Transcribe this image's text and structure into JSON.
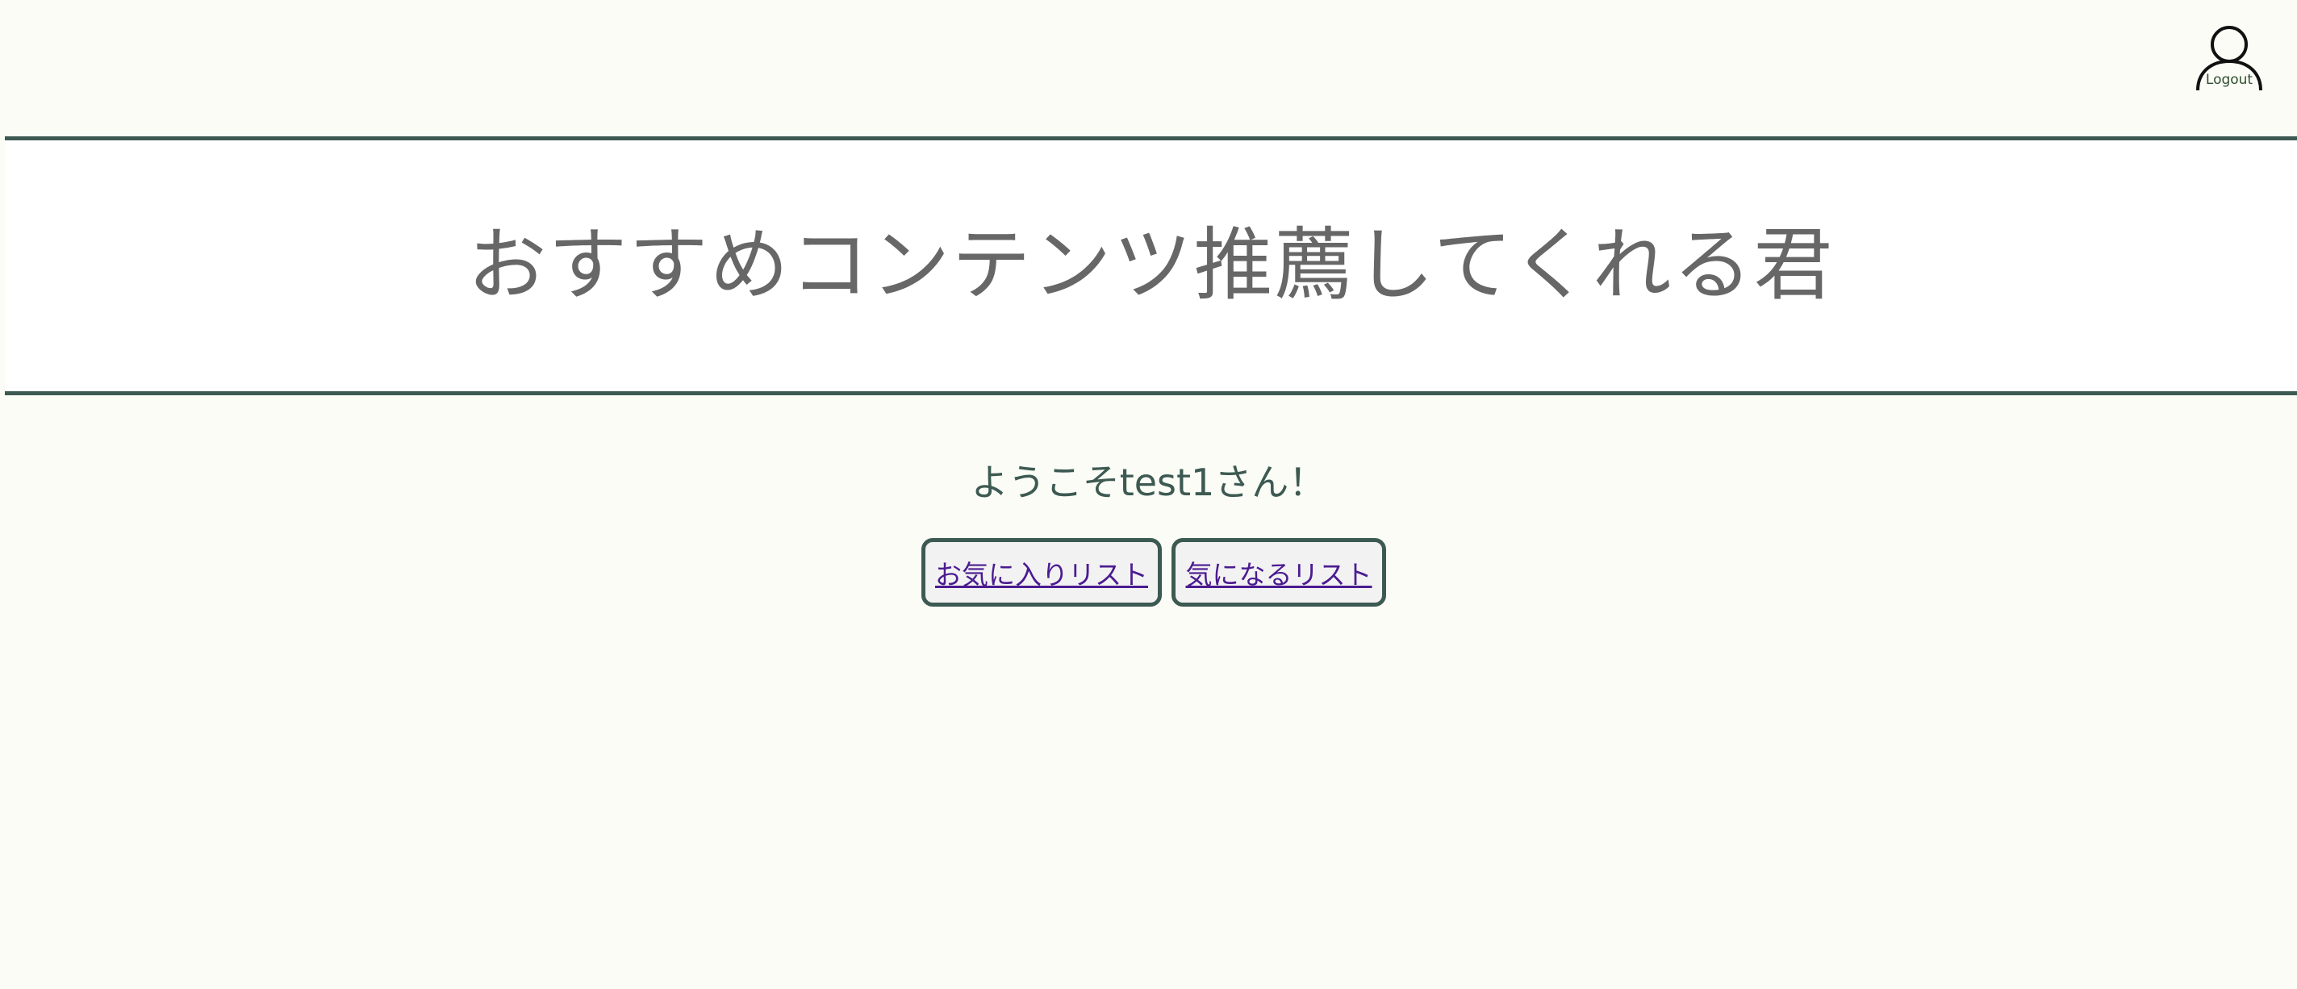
{
  "header": {
    "logout_label": "Logout",
    "logout_icon": "user-icon"
  },
  "site": {
    "title": "おすすめコンテンツ推薦してくれる君"
  },
  "welcome": {
    "message": "ようこそtest1さん！"
  },
  "nav": {
    "favorites_label": "お気に入りリスト",
    "watchlist_label": "気になるリスト"
  },
  "colors": {
    "background": "#fbfcf6",
    "accent": "#3d5a52",
    "title_text": "#676767",
    "link": "#4b1b91",
    "button_bg": "#f2f2f2"
  }
}
